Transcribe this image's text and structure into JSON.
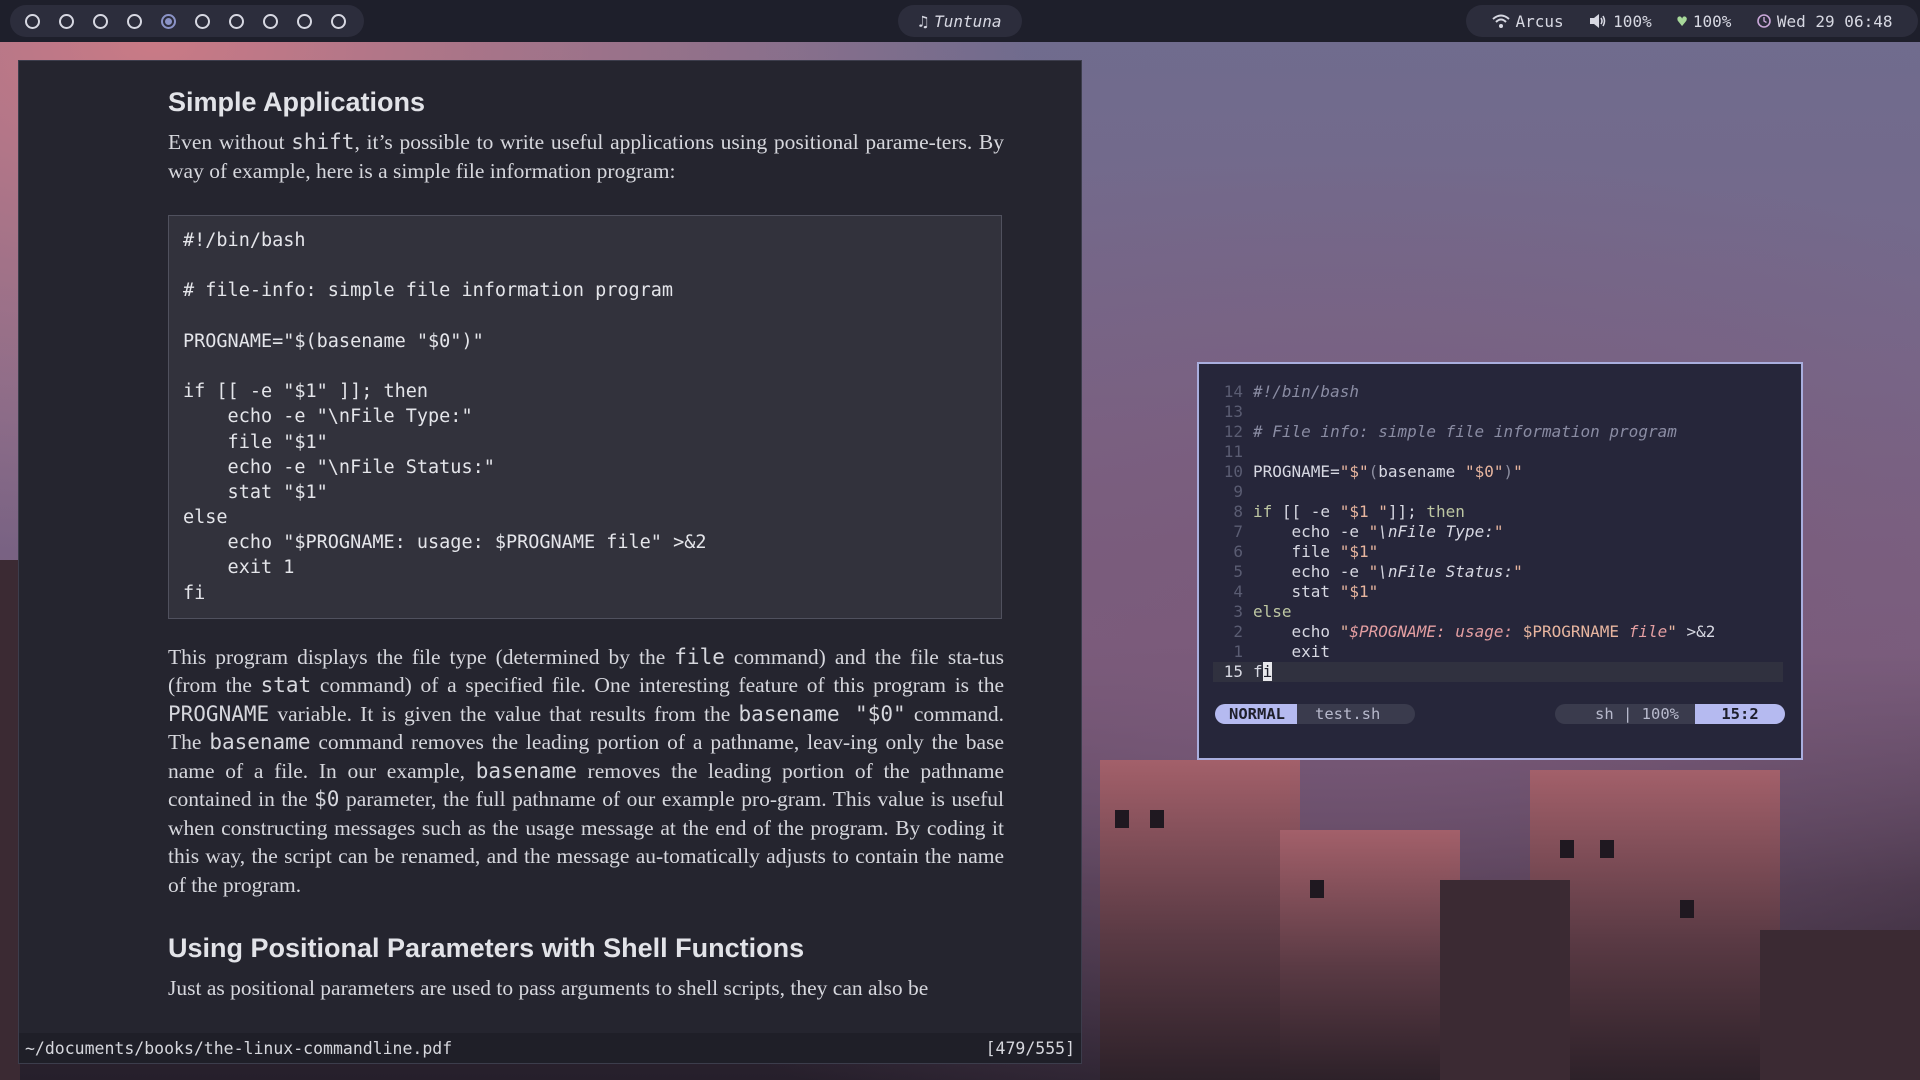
{
  "topbar": {
    "workspaces": [
      "1",
      "2",
      "3",
      "4",
      "5",
      "6",
      "7",
      "8",
      "9",
      "10"
    ],
    "active_workspace_index": 4,
    "music": {
      "icon": "music-note-icon",
      "title": "Tuntuna"
    },
    "wifi": {
      "icon": "wifi-icon",
      "ssid": "Arcus"
    },
    "volume": {
      "icon": "speaker-icon",
      "level": "100%"
    },
    "battery": {
      "icon": "heart-icon",
      "level": "100%"
    },
    "clock": {
      "icon": "clock-icon",
      "text": "Wed 29 06:48"
    }
  },
  "pdf": {
    "heading1": "Simple Applications",
    "intro": {
      "a": "Even without ",
      "code_shift": "shift",
      "b": ", it’s possible to write useful applications using positional parame-ters. By way of example, here is a simple file information program:"
    },
    "code": [
      "#!/bin/bash",
      "",
      "# file-info: simple file information program",
      "",
      "PROGNAME=\"$(basename \"$0\")\"",
      "",
      "if [[ -e \"$1\" ]]; then",
      "    echo -e \"\\nFile Type:\"",
      "    file \"$1\"",
      "    echo -e \"\\nFile Status:\"",
      "    stat \"$1\"",
      "else",
      "    echo \"$PROGNAME: usage: $PROGNAME file\" >&2",
      "    exit 1",
      "fi"
    ],
    "body": {
      "t1": "This program displays the file type (determined by the ",
      "c_file": "file",
      "t2": " command) and the file sta-tus (from the ",
      "c_stat": "stat",
      "t3": " command) of a specified file. One interesting feature of this program is the ",
      "c_progname": "PROGNAME",
      "t4": " variable. It is given the value that results from the ",
      "c_basename0": "basename \"$0\"",
      "t5": " command. The ",
      "c_basename1": "basename",
      "t6": " command removes the leading portion of a pathname, leav-ing only the base name of a file. In our example, ",
      "c_basename2": "basename",
      "t7": " removes the leading portion of the pathname contained in the ",
      "c_dollar0": "$0",
      "t8": " parameter, the full pathname of our example pro-gram. This value is useful when constructing messages such as the usage message at the end of the program. By coding it this way, the script can be renamed, and the message au-tomatically adjusts to contain the name of the program."
    },
    "heading2": "Using Positional Parameters with Shell Functions",
    "tail": "Just as positional parameters are used to pass arguments to shell scripts, they can also be",
    "status": {
      "path": "~/documents/books/the-linux-commandline.pdf",
      "page": "[479/555]"
    }
  },
  "vim": {
    "line_numbers": [
      "14",
      "13",
      "12",
      "11",
      "10",
      "9",
      "8",
      "7",
      "6",
      "5",
      "4",
      "3",
      "2",
      "1",
      "15"
    ],
    "line_14": "#!/bin/bash",
    "line_12": "# File info: simple file information program",
    "l10": {
      "a": "PROGNAME=",
      "b": "\"$\"",
      "c": "(",
      "d": "basename ",
      "e": "\"$0\"",
      "f": ")",
      "g": "\""
    },
    "l8": {
      "kw1": "if",
      "a": " [[ -e ",
      "s": "\"$1 \"",
      "b": "]]; ",
      "kw2": "then"
    },
    "l7": {
      "a": "    echo -e ",
      "s1": "\"",
      "esc": "\\nFile Type:",
      "s2": "\""
    },
    "l6": {
      "a": "    file ",
      "s": "\"$1\""
    },
    "l5": {
      "a": "    echo -e ",
      "s1": "\"",
      "esc": "\\nFile Status:",
      "s2": "\""
    },
    "l4": {
      "a": "    stat ",
      "s": "\"$1\""
    },
    "l3": {
      "kw": "else"
    },
    "l2": {
      "a": "    echo ",
      "s1": "\"",
      "v1": "$PROGNAME: usage: ",
      "plain": "$PROGRNAME ",
      "v2": "file",
      "s2": "\"",
      "b": " >&2"
    },
    "l1": {
      "a": "    exit"
    },
    "l15": {
      "a": "f",
      "cur": "i"
    },
    "statusline": {
      "mode": "NORMAL",
      "file": "test.sh",
      "filetype": "sh",
      "percent": "100%",
      "position": "15:2"
    }
  }
}
